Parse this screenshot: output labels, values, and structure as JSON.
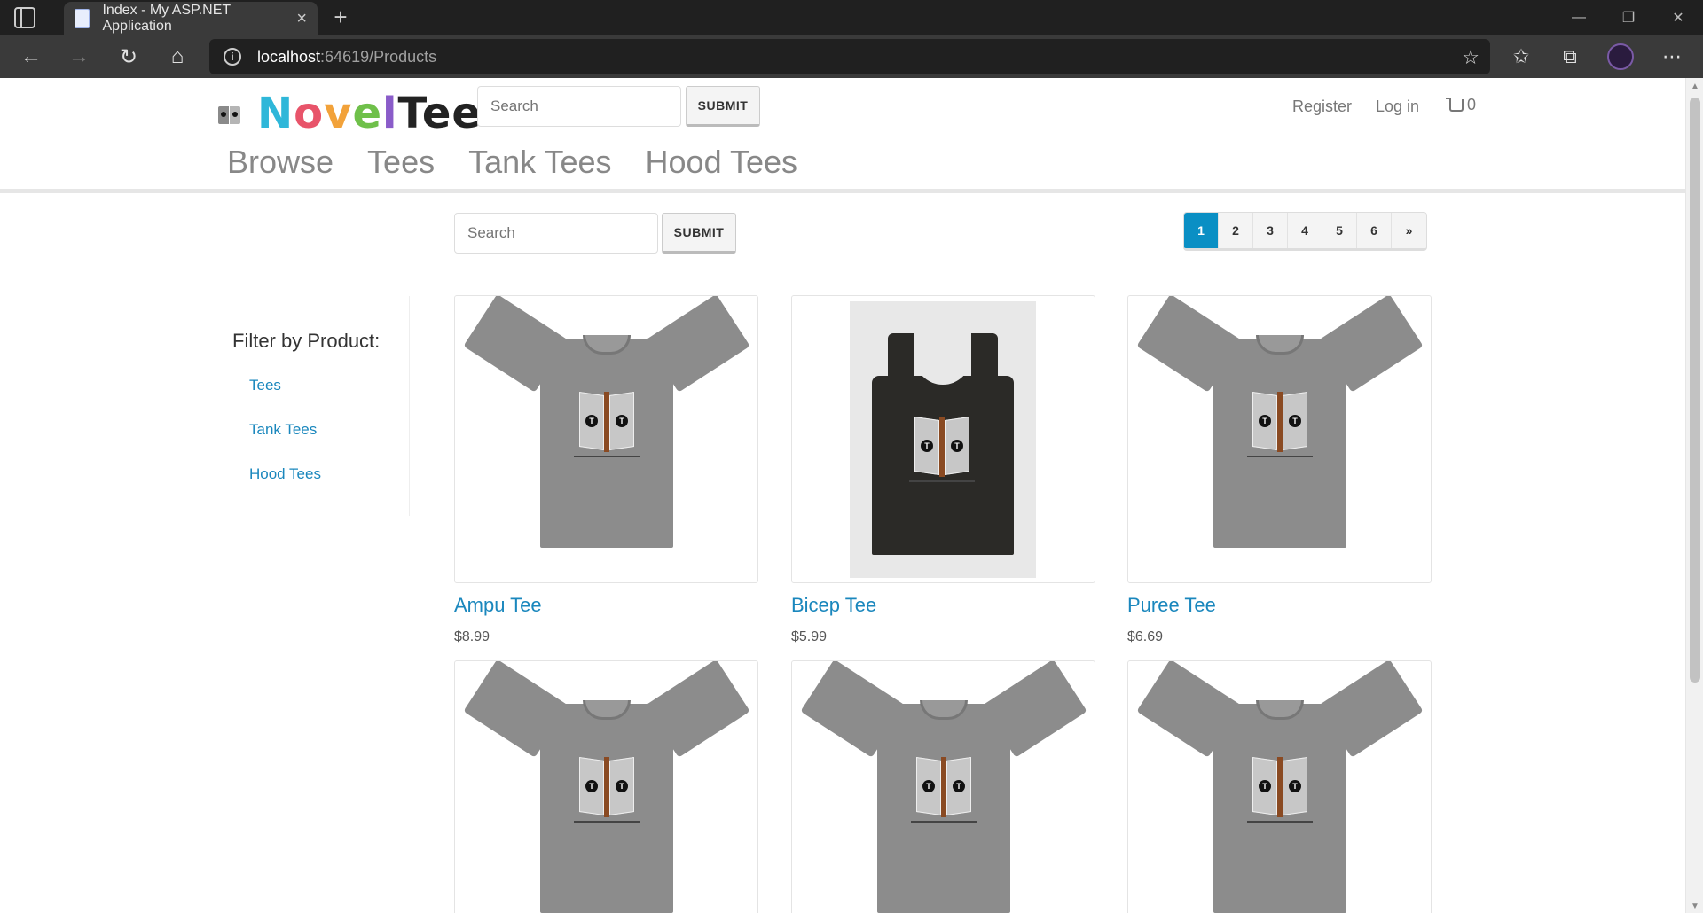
{
  "browser": {
    "tab_title": "Index - My ASP.NET Application",
    "url_host": "localhost",
    "url_path": ":64619/Products",
    "icons": [
      "sidebar-icon",
      "back-icon",
      "forward-icon",
      "refresh-icon",
      "home-icon",
      "info-icon",
      "add-favorite-icon",
      "favorites-icon",
      "collections-icon",
      "profile-avatar",
      "more-icon"
    ]
  },
  "header": {
    "logo_letters": [
      "N",
      "o",
      "v",
      "e",
      "l",
      "Tee"
    ],
    "search_placeholder": "Search",
    "submit_label": "SUBMIT",
    "register_label": "Register",
    "login_label": "Log in",
    "cart_count": "0",
    "nav": [
      "Browse",
      "Tees",
      "Tank Tees",
      "Hood Tees"
    ]
  },
  "content": {
    "search_placeholder": "Search",
    "submit_label": "SUBMIT",
    "pagination": [
      "1",
      "2",
      "3",
      "4",
      "5",
      "6",
      "»"
    ],
    "active_page": "1"
  },
  "filter": {
    "title": "Filter by Product:",
    "items": [
      "Tees",
      "Tank Tees",
      "Hood Tees"
    ]
  },
  "products": [
    {
      "name": "Ampu Tee",
      "price": "$8.99",
      "kind": "tee"
    },
    {
      "name": "Bicep Tee",
      "price": "$5.99",
      "kind": "tank"
    },
    {
      "name": "Puree Tee",
      "price": "$6.69",
      "kind": "tee"
    },
    {
      "name": "",
      "price": "",
      "kind": "tee"
    },
    {
      "name": "",
      "price": "",
      "kind": "tee"
    },
    {
      "name": "",
      "price": "",
      "kind": "tee"
    }
  ],
  "colors": {
    "accent": "#1a87bd",
    "active_page": "#0a8fc4",
    "nav_text": "#888888"
  }
}
